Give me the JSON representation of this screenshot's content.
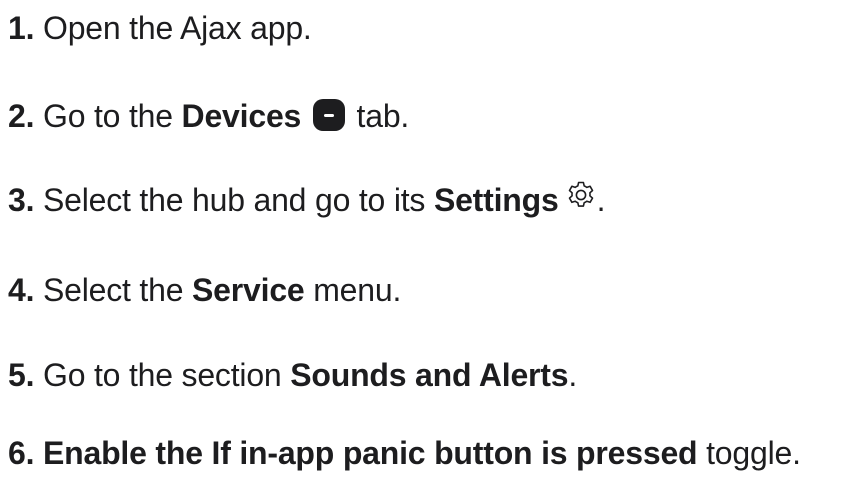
{
  "steps": [
    {
      "number": "1.",
      "text_before": "Open the Ajax app.",
      "bold": "",
      "text_after": ""
    },
    {
      "number": "2.",
      "text_before": "Go to the",
      "bold": "Devices",
      "icon": "devices-tab-icon",
      "text_after": "tab."
    },
    {
      "number": "3.",
      "text_before": "Select the hub and go to its",
      "bold": "Settings",
      "icon": "gear-icon",
      "text_after": "."
    },
    {
      "number": "4.",
      "text_before": "Select the",
      "bold": "Service",
      "text_after": "menu."
    },
    {
      "number": "5.",
      "text_before": "Go to the section",
      "bold": "Sounds and Alerts",
      "text_after": "."
    },
    {
      "number": "6.",
      "text_before": "",
      "bold": "Enable the If in-app panic button is pressed",
      "text_after": "toggle."
    }
  ],
  "colors": {
    "text": "#1d1d1f",
    "icon": "#1d1d1f",
    "background": "#ffffff"
  }
}
